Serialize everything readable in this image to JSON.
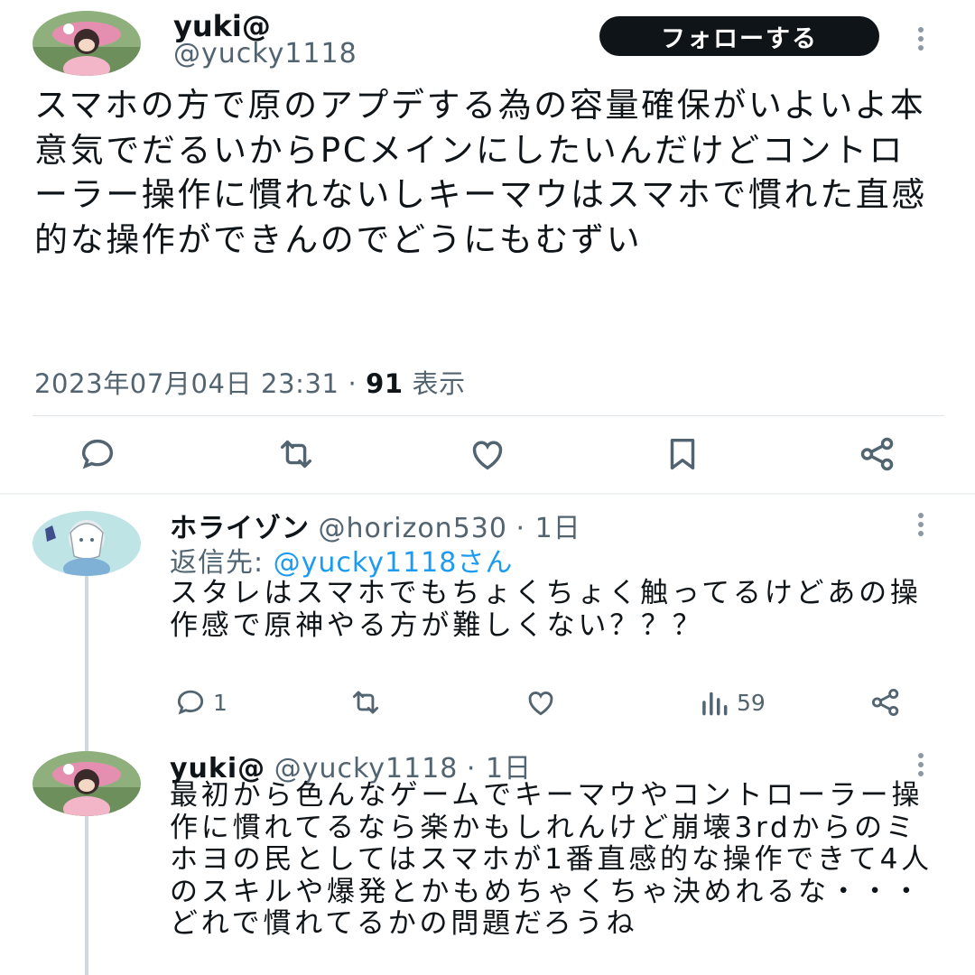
{
  "main_tweet": {
    "name": "yuki@",
    "handle": "@yucky1118",
    "follow_label": "フォローする",
    "text": "スマホの方で原のアプデする為の容量確保がいよいよ本意気でだるいからPCメインにしたいんだけどコントローラー操作に慣れないしキーマウはスマホで慣れた直感的な操作ができんのでどうにもむずい",
    "datetime": "2023年07月04日 23:31",
    "separator": "·",
    "views_count": "91",
    "views_label": "表示",
    "actions": [
      "reply-icon",
      "retweet-icon",
      "like-icon",
      "bookmark-icon",
      "share-icon"
    ]
  },
  "replies": [
    {
      "name": "ホライゾン",
      "handle": "@horizon530",
      "time": "· 1日",
      "replying_to_label": "返信先:",
      "replying_to_user": "@yucky1118さん",
      "text": "スタレはスマホでもちょくちょく触ってるけどあの操作感で原神やる方が難しくない？？？",
      "reply_count": "1",
      "view_count": "59"
    },
    {
      "name": "yuki@",
      "handle": "@yucky1118",
      "time": "· 1日",
      "text": "最初から色んなゲームでキーマウやコントローラー操作に慣れてるなら楽かもしれんけど崩壊3rdからのミホヨの民としてはスマホが1番直感的な操作できて4人のスキルや爆発とかもめちゃくちゃ決めれるな・・・どれで慣れてるかの問題だろうね"
    }
  ],
  "colors": {
    "text": "#0f1419",
    "secondary": "#536471",
    "link": "#1d9bf0",
    "follow_bg": "#0f1419"
  }
}
